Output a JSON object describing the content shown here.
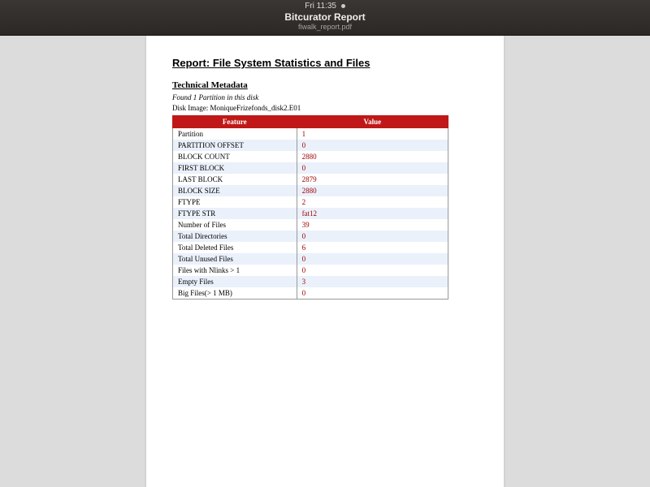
{
  "os_bar": {
    "clock": "Fri 11:35",
    "app_title": "Bitcurator Report",
    "app_subtitle": "fiwalk_report.pdf"
  },
  "report": {
    "title": "Report: File System Statistics and Files",
    "section": "Technical Metadata",
    "found_line": "Found 1 Partition in this disk",
    "disk_image_line": "Disk Image: MoniqueFrizefonds_disk2.E01"
  },
  "table": {
    "headers": {
      "feature": "Feature",
      "value": "Value"
    },
    "rows": [
      {
        "feature": "Partition",
        "value": "1"
      },
      {
        "feature": "PARTITION OFFSET",
        "value": "0"
      },
      {
        "feature": "BLOCK COUNT",
        "value": "2880"
      },
      {
        "feature": "FIRST BLOCK",
        "value": "0"
      },
      {
        "feature": "LAST BLOCK",
        "value": "2879"
      },
      {
        "feature": "BLOCK SIZE",
        "value": "2880"
      },
      {
        "feature": "FTYPE",
        "value": "2"
      },
      {
        "feature": "FTYPE STR",
        "value": "fat12"
      },
      {
        "feature": "Number of Files",
        "value": "39"
      },
      {
        "feature": "Total Directories",
        "value": "0"
      },
      {
        "feature": "Total Deleted Files",
        "value": "6"
      },
      {
        "feature": "Total Unused Files",
        "value": "0"
      },
      {
        "feature": "Files with Nlinks > 1",
        "value": "0"
      },
      {
        "feature": "Empty Files",
        "value": "3"
      },
      {
        "feature": "Big Files(> 1 MB)",
        "value": "0"
      }
    ]
  }
}
